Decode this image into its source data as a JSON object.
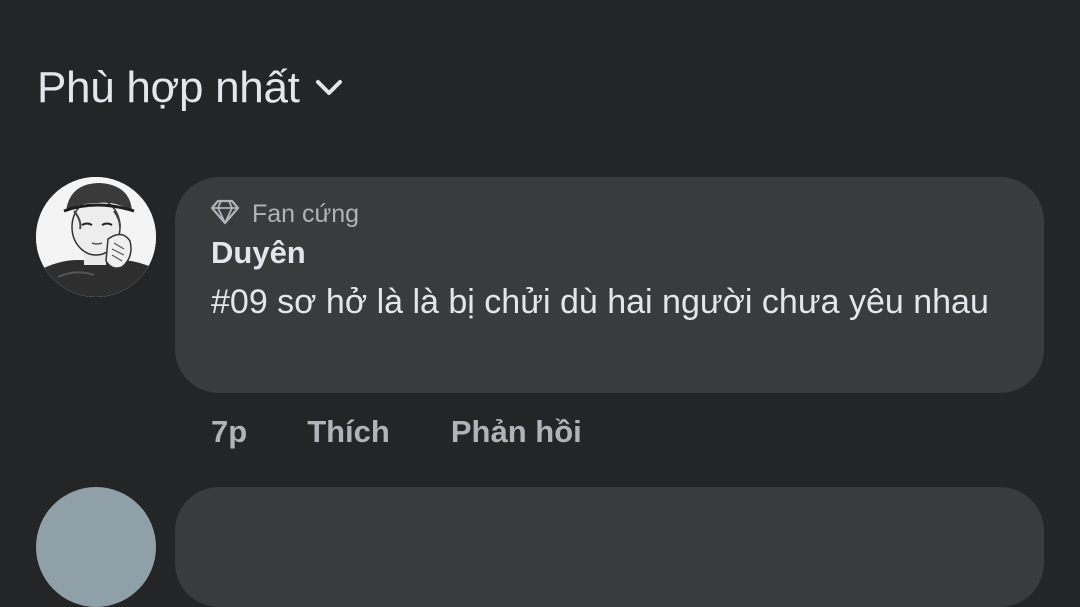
{
  "sort": {
    "label": "Phù hợp nhất",
    "icon": "chevron-down-icon"
  },
  "comment": {
    "badge_icon": "diamond-icon",
    "badge": "Fan cứng",
    "author": "Duyên",
    "text": "#09 sơ hở là là bị chửi dù hai người chưa yêu nhau",
    "time": "7p",
    "like_label": "Thích",
    "reply_label": "Phản hồi"
  },
  "colors": {
    "background": "#242526",
    "bubble": "#3a3b3c",
    "primary_text": "#e4e6eb",
    "secondary_text": "#b0b3b8"
  }
}
